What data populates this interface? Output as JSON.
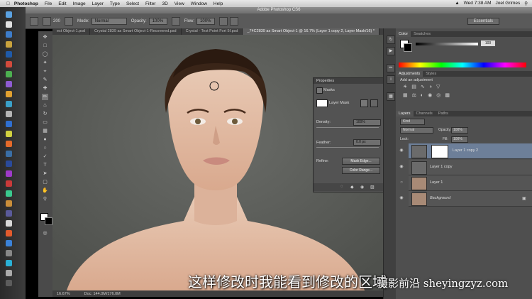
{
  "menubar": {
    "app": "Photoshop",
    "items": [
      "File",
      "Edit",
      "Image",
      "Layer",
      "Type",
      "Select",
      "Filter",
      "3D",
      "View",
      "Window",
      "Help"
    ],
    "clock": "Wed 7:38 AM",
    "user": "Joel Grimes"
  },
  "window": {
    "title": "Adobe Photoshop CS6"
  },
  "options": {
    "brush_size": "200",
    "mode_label": "Mode:",
    "mode_value": "Normal",
    "opacity_label": "Opacity:",
    "opacity_value": "100%",
    "flow_label": "Flow:",
    "flow_value": "100%",
    "workspace": "Essentials"
  },
  "tabs": [
    {
      "label": "ect Object-1.psd"
    },
    {
      "label": "Crystal 2839 as Smart Object-1-Recovered.psd"
    },
    {
      "label": "Crystal - Test Point Fort 5f.psd"
    },
    {
      "label": "_74C2839 as Smart Object-1 @ 16.7% (Layer 1 copy 2, Layer Mask/16) *"
    }
  ],
  "status": {
    "zoom": "16.67%",
    "doc": "Doc: 144.0M/176.0M"
  },
  "properties": {
    "title": "Properties",
    "section": "Masks",
    "mask_label": "Layer Mask",
    "density_label": "Density:",
    "density_value": "100%",
    "feather_label": "Feather:",
    "feather_value": "0.0 px",
    "refine_label": "Refine:",
    "mask_edge_btn": "Mask Edge...",
    "color_range_btn": "Color Range..."
  },
  "color_panel": {
    "tabs": [
      "Color",
      "Swatches"
    ],
    "value": "100"
  },
  "adjustments": {
    "tabs": [
      "Adjustments",
      "Styles"
    ],
    "hint": "Add an adjustment"
  },
  "layers_panel": {
    "tabs": [
      "Layers",
      "Channels",
      "Paths"
    ],
    "kind": "Kind",
    "blend": "Normal",
    "opacity_label": "Opacity:",
    "opacity_value": "100%",
    "lock_label": "Lock:",
    "fill_label": "Fill:",
    "fill_value": "100%",
    "layers": [
      {
        "name": "Layer 1 copy 2"
      },
      {
        "name": "Layer 1 copy"
      },
      {
        "name": "Layer 1"
      },
      {
        "name": "Background"
      }
    ]
  },
  "subtitle": "这样修改时我能看到修改的区域",
  "watermark": "摄影前沿 sheyingzyz.com"
}
